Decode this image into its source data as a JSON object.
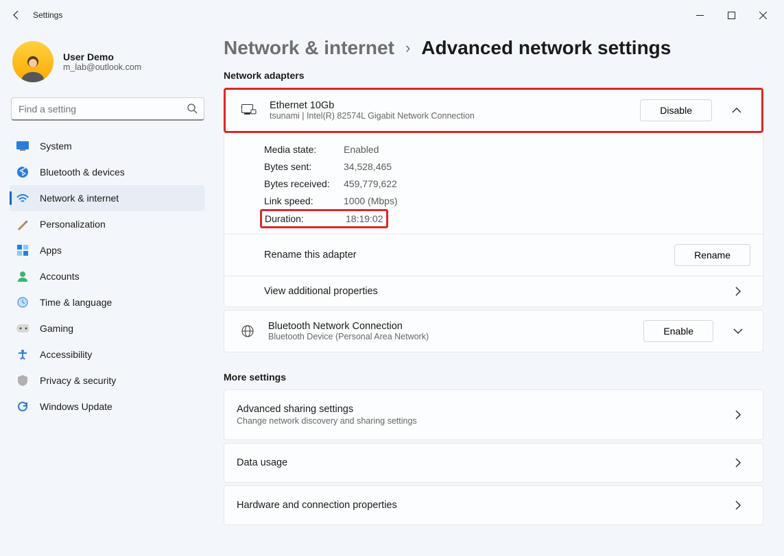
{
  "window": {
    "title": "Settings"
  },
  "user": {
    "name": "User Demo",
    "email": "m_lab@outlook.com"
  },
  "search": {
    "placeholder": "Find a setting"
  },
  "nav": [
    {
      "label": "System",
      "icon": "system"
    },
    {
      "label": "Bluetooth & devices",
      "icon": "bluetooth"
    },
    {
      "label": "Network & internet",
      "icon": "network",
      "active": true
    },
    {
      "label": "Personalization",
      "icon": "personalize"
    },
    {
      "label": "Apps",
      "icon": "apps"
    },
    {
      "label": "Accounts",
      "icon": "accounts"
    },
    {
      "label": "Time & language",
      "icon": "time"
    },
    {
      "label": "Gaming",
      "icon": "gaming"
    },
    {
      "label": "Accessibility",
      "icon": "accessibility"
    },
    {
      "label": "Privacy & security",
      "icon": "privacy"
    },
    {
      "label": "Windows Update",
      "icon": "update"
    }
  ],
  "breadcrumb": {
    "parent": "Network & internet",
    "current": "Advanced network settings"
  },
  "sections": {
    "adapters_header": "Network adapters",
    "more_header": "More settings"
  },
  "adapter1": {
    "title": "Ethernet 10Gb",
    "sub": "tsunami | Intel(R) 82574L Gigabit Network Connection",
    "button": "Disable",
    "details": {
      "media_state_k": "Media state:",
      "media_state_v": "Enabled",
      "bytes_sent_k": "Bytes sent:",
      "bytes_sent_v": "34,528,465",
      "bytes_recv_k": "Bytes received:",
      "bytes_recv_v": "459,779,622",
      "link_speed_k": "Link speed:",
      "link_speed_v": "1000 (Mbps)",
      "duration_k": "Duration:",
      "duration_v": "18:19:02"
    },
    "rename_label": "Rename this adapter",
    "rename_button": "Rename",
    "view_props": "View additional properties"
  },
  "adapter2": {
    "title": "Bluetooth Network Connection",
    "sub": "Bluetooth Device (Personal Area Network)",
    "button": "Enable"
  },
  "more": {
    "sharing_t": "Advanced sharing settings",
    "sharing_s": "Change network discovery and sharing settings",
    "data_usage": "Data usage",
    "hw_props": "Hardware and connection properties"
  }
}
